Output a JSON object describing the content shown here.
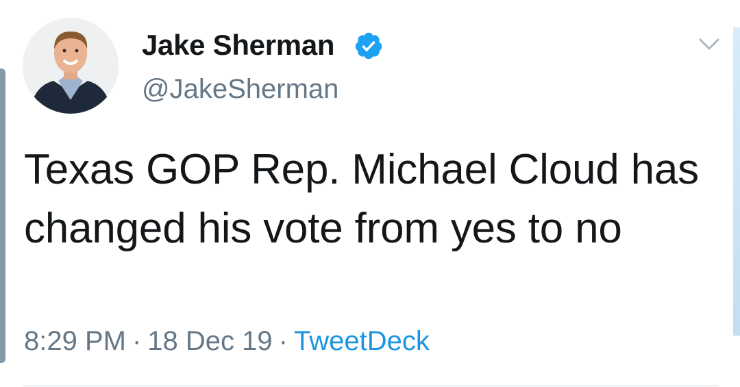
{
  "tweet": {
    "author": {
      "display_name": "Jake Sherman",
      "handle": "@JakeSherman",
      "verified": true,
      "verified_icon": "verified-badge-icon"
    },
    "text": "Texas GOP Rep. Michael Cloud has changed his vote from yes to no",
    "time": "8:29 PM",
    "date": "18 Dec 19",
    "source": "TweetDeck",
    "separator": "·",
    "menu_icon": "chevron-down-icon"
  },
  "colors": {
    "text_primary": "#14171a",
    "text_secondary": "#657786",
    "accent": "#1b95e0",
    "verified": "#1da1f2"
  }
}
